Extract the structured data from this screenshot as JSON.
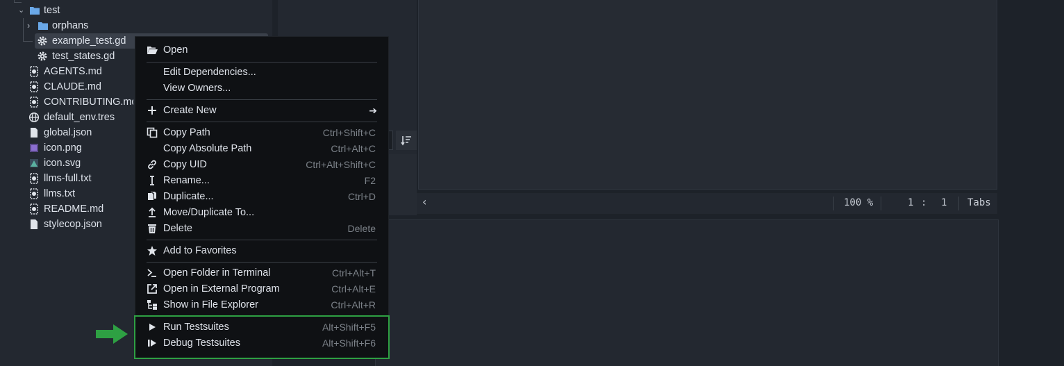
{
  "colors": {
    "folder": "#6aa8e8",
    "highlight": "#2ea043",
    "arrow": "#2ea043"
  },
  "filetree": {
    "items": [
      {
        "label": "test",
        "icon": "folder-icon"
      },
      {
        "label": "orphans",
        "icon": "folder-icon"
      },
      {
        "label": "example_test.gd",
        "icon": "gear-icon"
      },
      {
        "label": "test_states.gd",
        "icon": "gear-icon"
      },
      {
        "label": "AGENTS.md",
        "icon": "markdown-icon"
      },
      {
        "label": "CLAUDE.md",
        "icon": "markdown-icon"
      },
      {
        "label": "CONTRIBUTING.md",
        "icon": "markdown-icon"
      },
      {
        "label": "default_env.tres",
        "icon": "globe-icon"
      },
      {
        "label": "global.json",
        "icon": "file-icon"
      },
      {
        "label": "icon.png",
        "icon": "image-icon"
      },
      {
        "label": "icon.svg",
        "icon": "image-icon"
      },
      {
        "label": "llms-full.txt",
        "icon": "markdown-icon"
      },
      {
        "label": "llms.txt",
        "icon": "markdown-icon"
      },
      {
        "label": "README.md",
        "icon": "markdown-icon"
      },
      {
        "label": "stylecop.json",
        "icon": "file-icon"
      }
    ]
  },
  "editor": {
    "sort_icon": "sort-icon",
    "scroll_left": "‹",
    "zoom": "100 %",
    "line": "1",
    "col_sep": ":",
    "col": "1",
    "indent": "Tabs"
  },
  "context_menu": {
    "items": [
      {
        "label": "Open",
        "shortcut": "",
        "icon": "folder-open-icon"
      },
      {
        "label": "Edit Dependencies...",
        "shortcut": "",
        "icon": ""
      },
      {
        "label": "View Owners...",
        "shortcut": "",
        "icon": ""
      },
      {
        "label": "Create New",
        "shortcut": "",
        "icon": "plus-icon",
        "submenu_arrow": "➔"
      },
      {
        "label": "Copy Path",
        "shortcut": "Ctrl+Shift+C",
        "icon": "copy-icon"
      },
      {
        "label": "Copy Absolute Path",
        "shortcut": "Ctrl+Alt+C",
        "icon": ""
      },
      {
        "label": "Copy UID",
        "shortcut": "Ctrl+Alt+Shift+C",
        "icon": "link-icon"
      },
      {
        "label": "Rename...",
        "shortcut": "F2",
        "icon": "rename-icon"
      },
      {
        "label": "Duplicate...",
        "shortcut": "Ctrl+D",
        "icon": "duplicate-icon"
      },
      {
        "label": "Move/Duplicate To...",
        "shortcut": "",
        "icon": "move-icon"
      },
      {
        "label": "Delete",
        "shortcut": "Delete",
        "icon": "trash-icon"
      },
      {
        "label": "Add to Favorites",
        "shortcut": "",
        "icon": "star-icon"
      },
      {
        "label": "Open Folder in Terminal",
        "shortcut": "Ctrl+Alt+T",
        "icon": "terminal-icon"
      },
      {
        "label": "Open in External Program",
        "shortcut": "Ctrl+Alt+E",
        "icon": "external-icon"
      },
      {
        "label": "Show in File Explorer",
        "shortcut": "Ctrl+Alt+R",
        "icon": "filesystem-icon"
      },
      {
        "label": "Run Testsuites",
        "shortcut": "Alt+Shift+F5",
        "icon": "play-icon"
      },
      {
        "label": "Debug Testsuites",
        "shortcut": "Alt+Shift+F6",
        "icon": "debug-icon"
      }
    ]
  }
}
